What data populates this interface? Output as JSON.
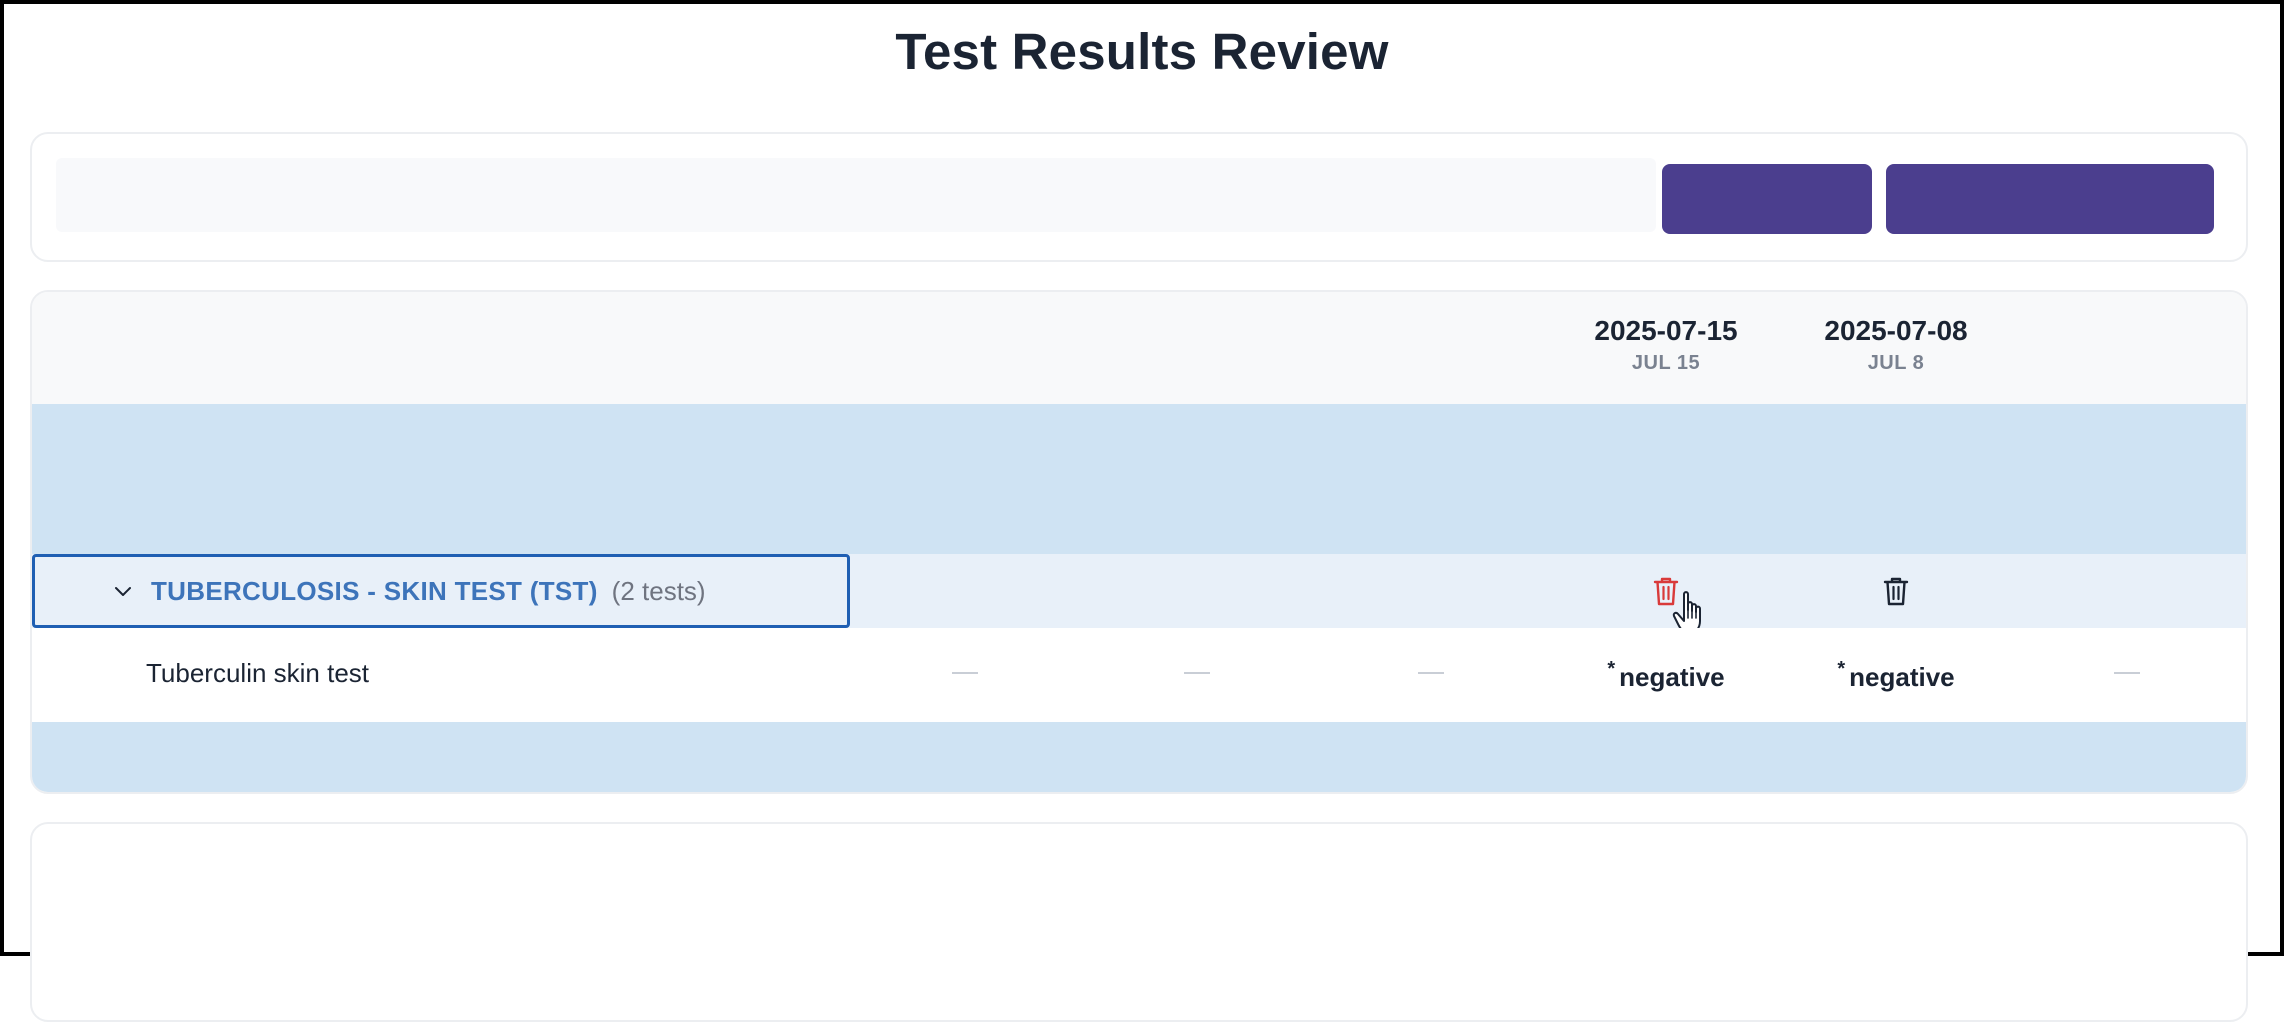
{
  "page": {
    "title": "Test Results Review"
  },
  "toolbar": {
    "search_value": "",
    "button_one_label": "",
    "button_two_label": ""
  },
  "results": {
    "dates": [
      {
        "date": "2025-07-15",
        "short": "JUL 15"
      },
      {
        "date": "2025-07-08",
        "short": "JUL 8"
      }
    ],
    "group": {
      "title": "TUBERCULOSIS - SKIN TEST (TST)",
      "count": "(2 tests)"
    },
    "tests": [
      {
        "name": "Tuberculin skin test",
        "empty_marker": "—",
        "results": [
          {
            "flag": "*",
            "value": "negative"
          },
          {
            "flag": "*",
            "value": "negative"
          }
        ]
      }
    ]
  },
  "colors": {
    "primary": "#4b3e8e",
    "group_text": "#3d74ba",
    "band": "#cfe3f3",
    "group_row": "#e8f0f9",
    "delete_hover": "#d93a3a"
  },
  "icons": {
    "expand": "chevron-down-icon",
    "delete": "trash-icon",
    "cursor": "hand-pointer-icon"
  }
}
